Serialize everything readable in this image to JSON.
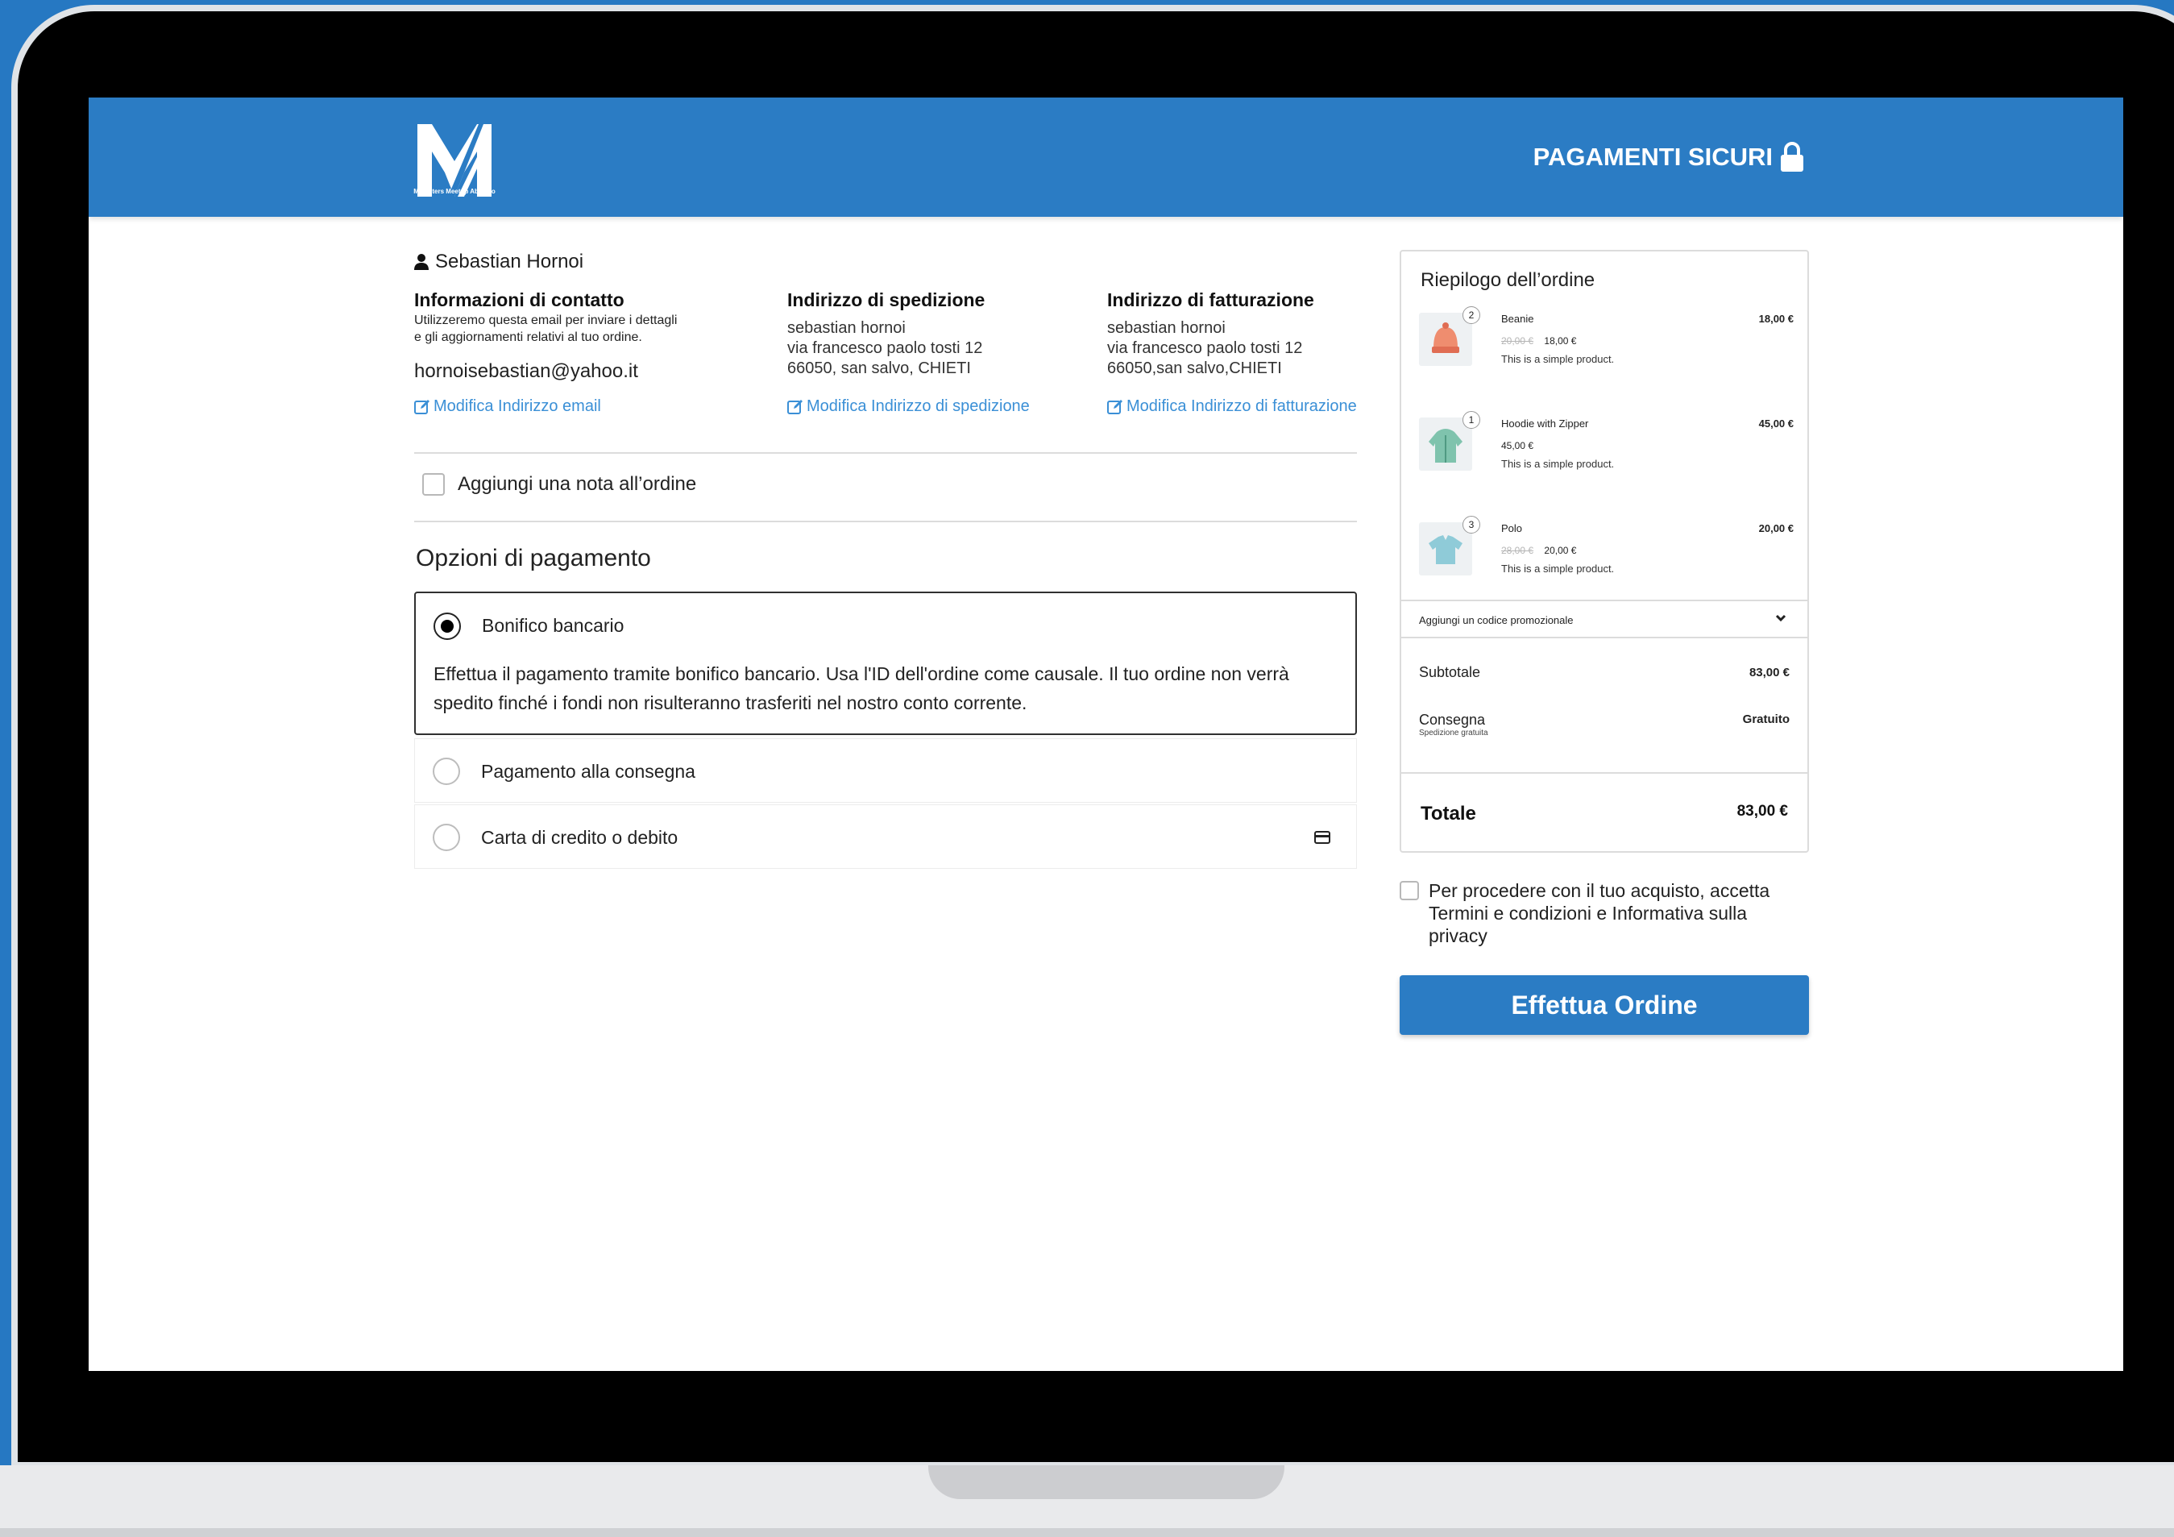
{
  "header": {
    "logo_sub": "Marketers Meetup Abruzzo",
    "secure_label": "PAGAMENTI SICURI"
  },
  "user": {
    "name": "Sebastian Hornoi"
  },
  "contact": {
    "title": "Informazioni di contatto",
    "desc_1": "Utilizzeremo questa email per inviare i dettagli",
    "desc_2": "e gli aggiornamenti relativi al tuo ordine.",
    "email": "hornoisebastian@yahoo.it",
    "edit_link": "Modifica Indirizzo email"
  },
  "shipping": {
    "title": "Indirizzo di spedizione",
    "line1": "sebastian hornoi",
    "line2": "via francesco paolo tosti 12",
    "line3": "66050, san salvo, CHIETI",
    "edit_link": "Modifica Indirizzo di spedizione"
  },
  "billing": {
    "title": "Indirizzo di fatturazione",
    "line1": "sebastian hornoi",
    "line2": "via francesco paolo tosti 12",
    "line3": "66050,san salvo,CHIETI",
    "edit_link": "Modifica Indirizzo di fatturazione"
  },
  "order_note": {
    "label": "Aggiungi una nota all’ordine"
  },
  "payment": {
    "title": "Opzioni di pagamento",
    "options": [
      {
        "label": "Bonifico bancario",
        "selected": true
      },
      {
        "label": "Pagamento alla consegna",
        "selected": false
      },
      {
        "label": "Carta di credito o debito",
        "selected": false
      }
    ],
    "bank_desc": "Effettua il pagamento tramite bonifico bancario. Usa l'ID dell'ordine come causale. Il tuo ordine non verrà spedito finché i fondi non risulteranno trasferiti nel nostro conto corrente."
  },
  "summary": {
    "title": "Riepilogo dell’ordine",
    "products": [
      {
        "name": "Beanie",
        "qty": "2",
        "old_price": "20,00 €",
        "price": "18,00 €",
        "desc": "This is a simple product.",
        "total": "18,00 €",
        "icon": "beanie-icon",
        "color": "#ef8d6f"
      },
      {
        "name": "Hoodie with Zipper",
        "qty": "1",
        "old_price": "",
        "price": "45,00 €",
        "desc": "This is a simple product.",
        "total": "45,00 €",
        "icon": "hoodie-icon",
        "color": "#7fc3ad"
      },
      {
        "name": "Polo",
        "qty": "3",
        "old_price": "28,00 €",
        "price": "20,00 €",
        "desc": "This is a simple product.",
        "total": "20,00 €",
        "icon": "polo-icon",
        "color": "#8fcbd8"
      }
    ],
    "promo": "Aggiungi un codice promozionale",
    "subtotal_label": "Subtotale",
    "subtotal_value": "83,00 €",
    "shipping_label": "Consegna",
    "shipping_sub": "Spedizione gratuita",
    "shipping_value": "Gratuito",
    "total_label": "Totale",
    "total_value": "83,00 €"
  },
  "terms": {
    "text": "Per procedere con il tuo acquisto, accetta Termini e condizioni e Informativa sulla privacy"
  },
  "order_button": {
    "label": "Effettua Ordine"
  },
  "colors": {
    "brand": "#2b7cc4",
    "link": "#3a8fd6"
  }
}
